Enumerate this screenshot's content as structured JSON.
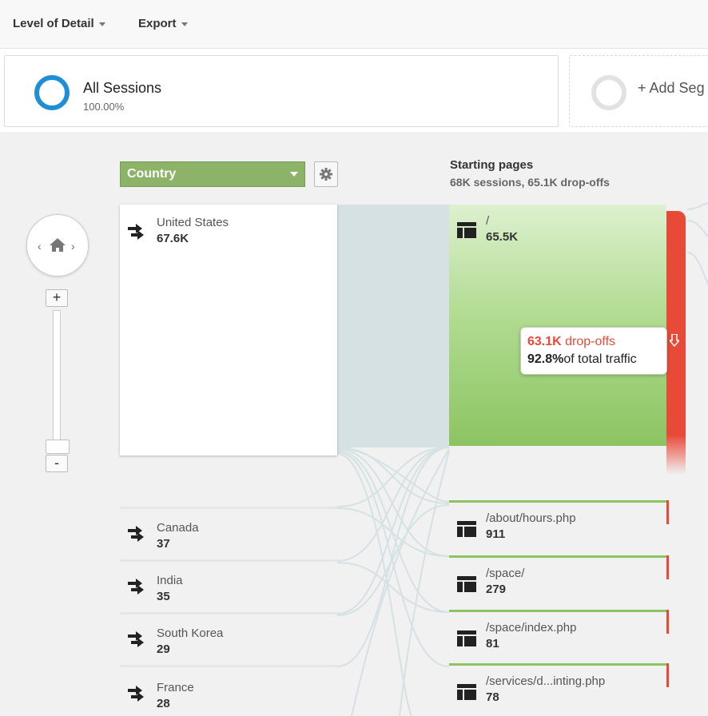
{
  "toolbar": {
    "level_of_detail": "Level of Detail",
    "export": "Export"
  },
  "segments": {
    "all_sessions": {
      "title": "All Sessions",
      "percent": "100.00%"
    },
    "add_segment": "+ Add Seg"
  },
  "dimension": {
    "selected": "Country"
  },
  "column": {
    "title": "Starting pages",
    "subtitle": "68K sessions, 65.1K drop-offs"
  },
  "countries": [
    {
      "name": "United States",
      "value": "67.6K"
    },
    {
      "name": "Canada",
      "value": "37"
    },
    {
      "name": "India",
      "value": "35"
    },
    {
      "name": "South Korea",
      "value": "29"
    },
    {
      "name": "France",
      "value": "28"
    }
  ],
  "pages": [
    {
      "name": "/",
      "value": "65.5K"
    },
    {
      "name": "/about/hours.php",
      "value": "911"
    },
    {
      "name": "/space/",
      "value": "279"
    },
    {
      "name": "/space/index.php",
      "value": "81"
    },
    {
      "name": "/services/d...inting.php",
      "value": "78"
    }
  ],
  "dropoff": {
    "count": "63.1K",
    "label": "drop-offs",
    "percent": "92.8%",
    "percent_label": "of total traffic"
  },
  "colors": {
    "country_select": "#8db368",
    "page_green_top": "#ddf0cf",
    "page_green_bottom": "#8cc462",
    "dropoff_red": "#e84a38",
    "flow": "#d5e1e3",
    "donut_blue": "#1e8fd6"
  },
  "icons": {
    "home": "home-icon",
    "gear": "gear-icon",
    "country": "arrows-icon",
    "page": "page-icon"
  }
}
